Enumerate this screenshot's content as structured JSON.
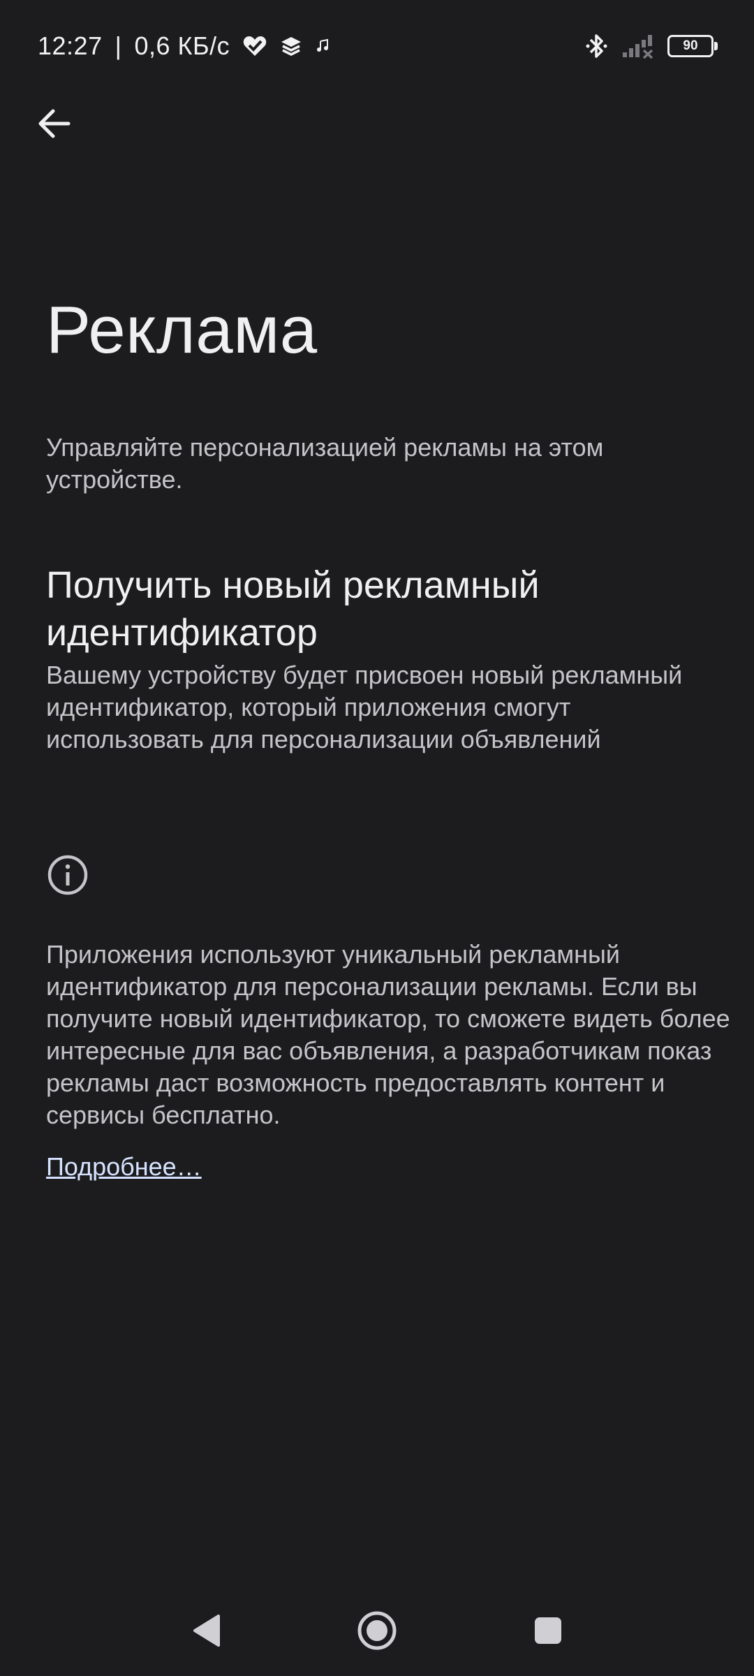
{
  "status_bar": {
    "time": "12:27",
    "separator": "|",
    "network_speed": "0,6 КБ/с",
    "battery_level": "90",
    "icons": [
      "heart-check-icon",
      "layers-icon",
      "music-note-icon",
      "bluetooth-icon",
      "signal-no-service-icon",
      "battery-icon"
    ]
  },
  "toolbar": {
    "back_icon": "arrow-back-icon"
  },
  "page": {
    "title": "Реклама",
    "subtitle": "Управляйте персонализацией рекламы на этом устройстве."
  },
  "reset_ad_id": {
    "title": "Получить новый рекламный идентификатор",
    "summary": "Вашему устройству будет присвоен новый рекламный идентификатор, который приложения смогут использовать для персонализации объявлений"
  },
  "info": {
    "icon": "info-icon",
    "text": "Приложения используют уникальный рекламный идентификатор для персонализации рекламы. Если вы получите новый идентификатор, то сможете видеть более интересные для вас объявления, а разработчикам показ рекламы даст возможность предоставлять контент и сервисы бесплатно.",
    "learn_more": "Подробнее…"
  },
  "navigation": {
    "icons": [
      "nav-back-icon",
      "nav-home-icon",
      "nav-recents-icon"
    ]
  },
  "colors": {
    "background": "#1c1c1e",
    "primary_text": "#f0f0f2",
    "secondary_text": "#c5c5c9",
    "link": "#d6e3ff"
  }
}
